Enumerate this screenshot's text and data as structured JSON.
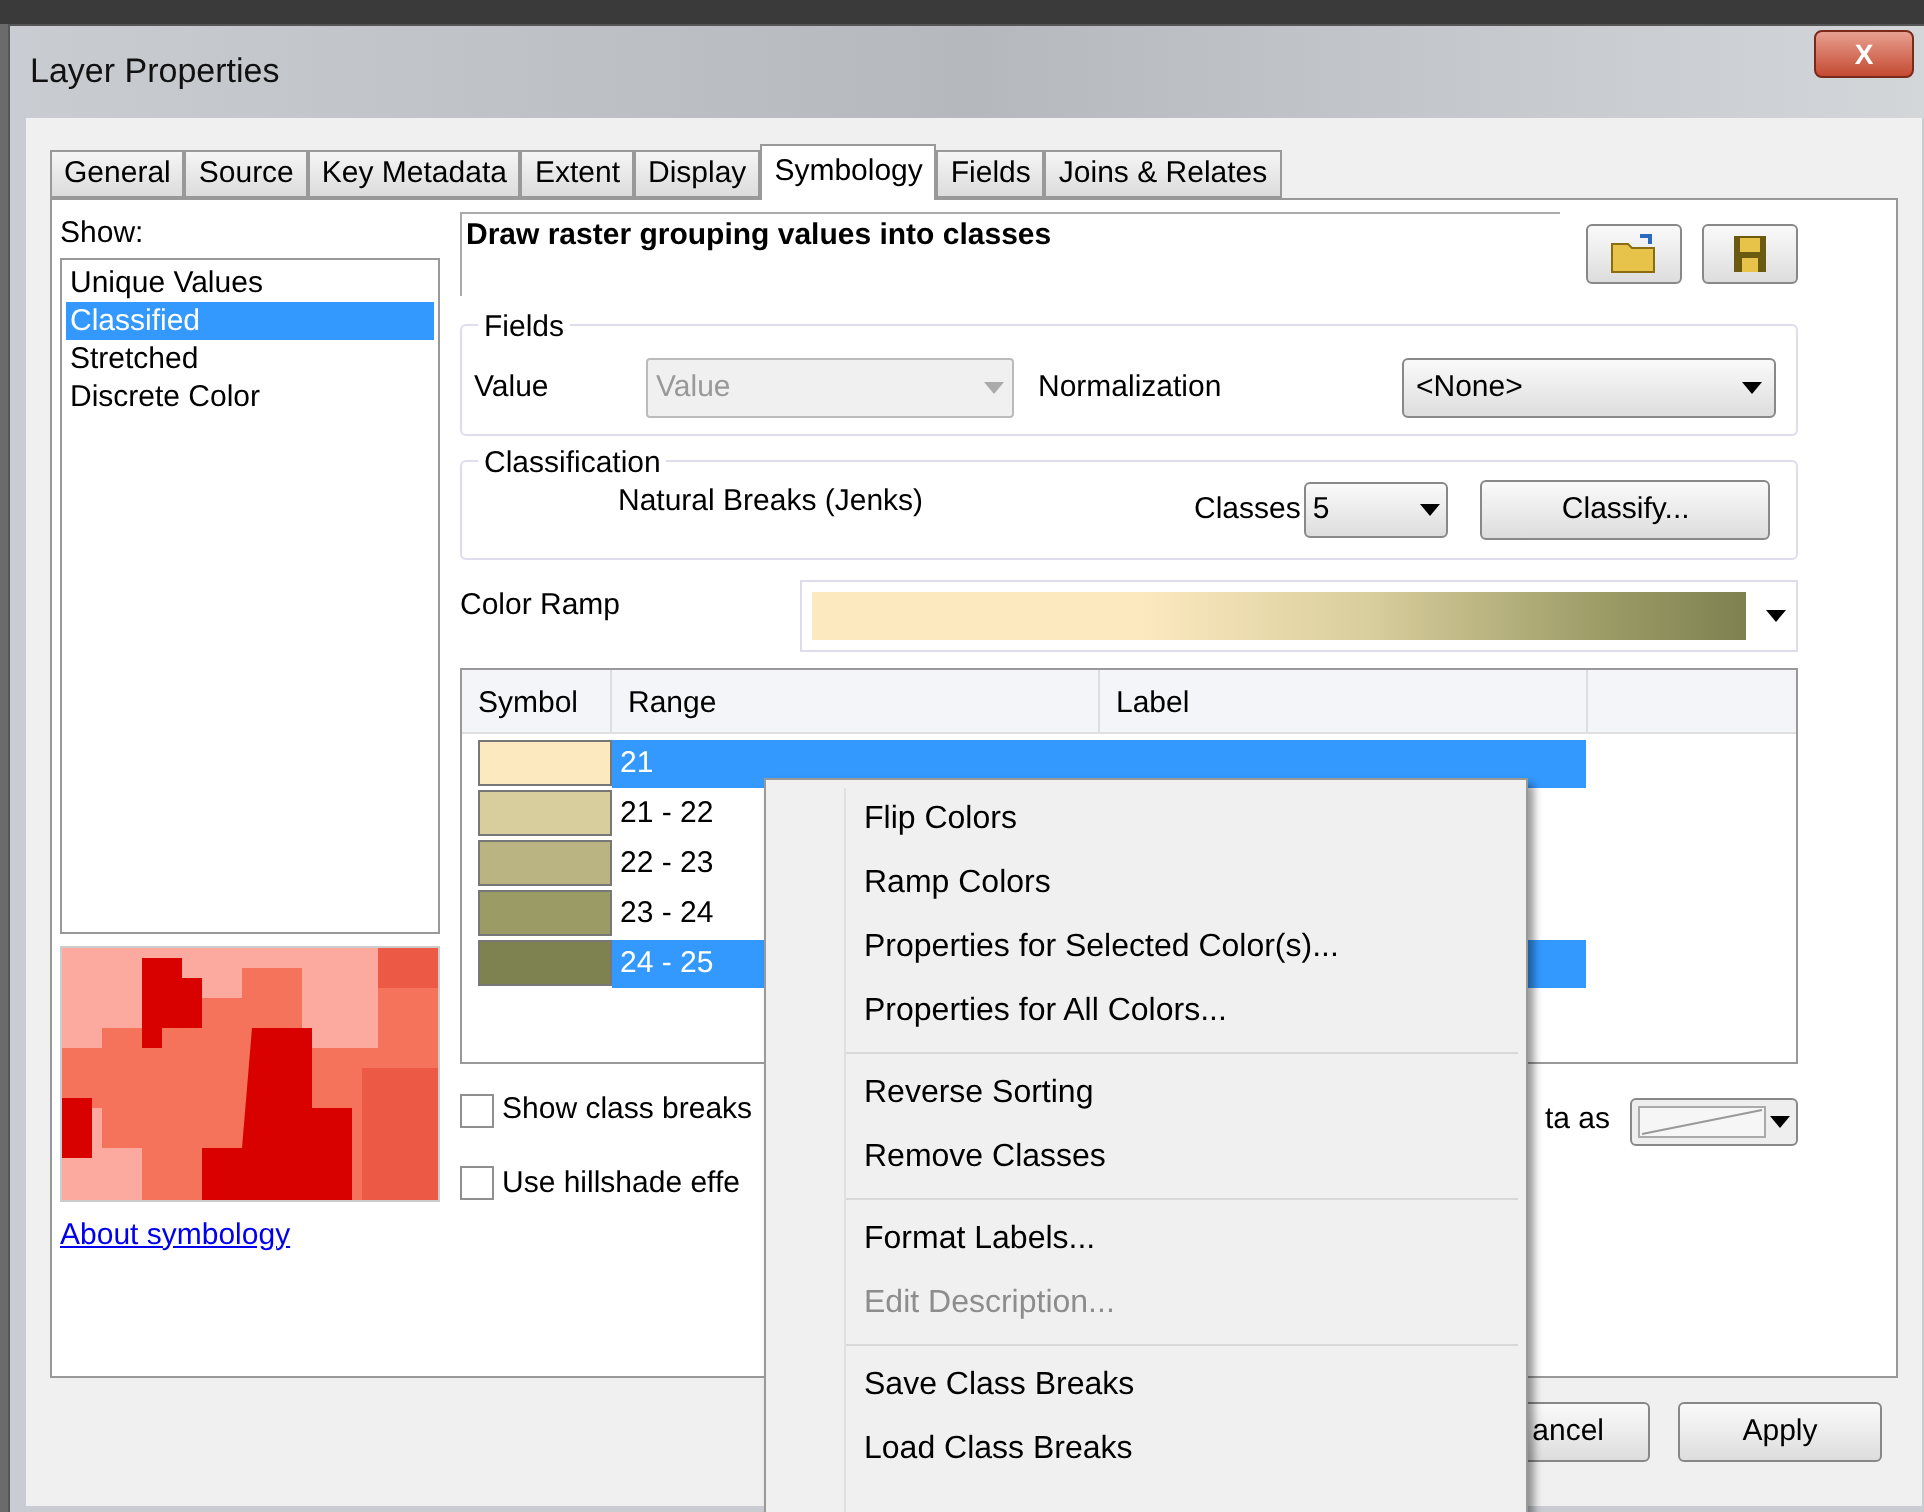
{
  "window": {
    "title": "Layer Properties",
    "close": "X"
  },
  "tabs": [
    {
      "label": "General",
      "selected": false
    },
    {
      "label": "Source",
      "selected": false
    },
    {
      "label": "Key Metadata",
      "selected": false
    },
    {
      "label": "Extent",
      "selected": false
    },
    {
      "label": "Display",
      "selected": false
    },
    {
      "label": "Symbology",
      "selected": true
    },
    {
      "label": "Fields",
      "selected": false
    },
    {
      "label": "Joins & Relates",
      "selected": false
    }
  ],
  "show": {
    "label": "Show:",
    "items": [
      {
        "label": "Unique Values",
        "selected": false
      },
      {
        "label": "Classified",
        "selected": true
      },
      {
        "label": "Stretched",
        "selected": false
      },
      {
        "label": "Discrete Color",
        "selected": false
      }
    ],
    "link": "About symbology"
  },
  "heading": "Draw raster grouping values into classes",
  "fields": {
    "title": "Fields",
    "value_label": "Value",
    "value": "Value",
    "value_disabled": true,
    "normalization_label": "Normalization",
    "normalization": "<None>"
  },
  "classification": {
    "title": "Classification",
    "method": "Natural Breaks (Jenks)",
    "classes_label": "Classes",
    "classes": "5",
    "classify": "Classify..."
  },
  "color_ramp": {
    "label": "Color Ramp"
  },
  "table": {
    "columns": [
      "Symbol",
      "Range",
      "Label"
    ],
    "rows": [
      {
        "range": "21",
        "color": "#fde9c0",
        "selected": true
      },
      {
        "range": "21 - 22",
        "color": "#d8cd9c",
        "selected": false
      },
      {
        "range": "22 - 23",
        "color": "#b9b482",
        "selected": false
      },
      {
        "range": "23 - 24",
        "color": "#9b9b66",
        "selected": false
      },
      {
        "range": "24 - 25",
        "color": "#7e8150",
        "selected": true
      }
    ]
  },
  "options": [
    {
      "label": "Show class breaks",
      "checked": false
    },
    {
      "label": "Use hillshade effe",
      "checked": false
    }
  ],
  "display_label": "ta as",
  "buttons": [
    "ancel",
    "Apply"
  ],
  "context_menu": [
    [
      {
        "label": "Flip Colors",
        "disabled": false
      },
      {
        "label": "Ramp Colors",
        "disabled": false
      },
      {
        "label": "Properties for Selected Color(s)...",
        "disabled": false
      },
      {
        "label": "Properties for All Colors...",
        "disabled": false
      }
    ],
    [
      {
        "label": "Reverse Sorting",
        "disabled": false
      },
      {
        "label": "Remove Classes",
        "disabled": false
      }
    ],
    [
      {
        "label": "Format Labels...",
        "disabled": false
      },
      {
        "label": "Edit Description...",
        "disabled": true
      }
    ],
    [
      {
        "label": "Save Class Breaks",
        "disabled": false
      },
      {
        "label": "Load Class Breaks",
        "disabled": false
      }
    ]
  ]
}
